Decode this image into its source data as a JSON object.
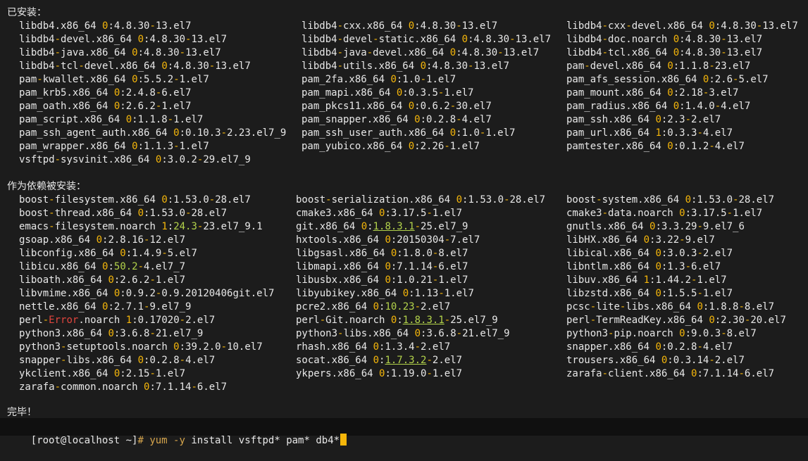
{
  "colors": {
    "background": "#1c1c1c",
    "text": "#e8e8e8",
    "epoch": "#f5b60a",
    "epoch_green": "#b3d34b",
    "hyphen": "#f5b60a",
    "error": "#e0453e",
    "command": "#d6a54c",
    "prompt_hash": "#d6a54c",
    "cursor": "#f5b60a"
  },
  "installed_heading": "已安装：",
  "installed": [
    [
      "libdb4.x86_64 0:4.8.30-13.el7",
      "libdb4-cxx.x86_64 0:4.8.30-13.el7",
      "libdb4-cxx-devel.x86_64 0:4.8.30-13.el7"
    ],
    [
      "libdb4-devel.x86_64 0:4.8.30-13.el7",
      "libdb4-devel-static.x86_64 0:4.8.30-13.el7",
      "libdb4-doc.noarch 0:4.8.30-13.el7"
    ],
    [
      "libdb4-java.x86_64 0:4.8.30-13.el7",
      "libdb4-java-devel.x86_64 0:4.8.30-13.el7",
      "libdb4-tcl.x86_64 0:4.8.30-13.el7"
    ],
    [
      "libdb4-tcl-devel.x86_64 0:4.8.30-13.el7",
      "libdb4-utils.x86_64 0:4.8.30-13.el7",
      "pam-devel.x86_64 0:1.1.8-23.el7"
    ],
    [
      "pam-kwallet.x86_64 0:5.5.2-1.el7",
      "pam_2fa.x86_64 0:1.0-1.el7",
      "pam_afs_session.x86_64 0:2.6-5.el7"
    ],
    [
      "pam_krb5.x86_64 0:2.4.8-6.el7",
      "pam_mapi.x86_64 0:0.3.5-1.el7",
      "pam_mount.x86_64 0:2.18-3.el7"
    ],
    [
      "pam_oath.x86_64 0:2.6.2-1.el7",
      "pam_pkcs11.x86_64 0:0.6.2-30.el7",
      "pam_radius.x86_64 0:1.4.0-4.el7"
    ],
    [
      "pam_script.x86_64 0:1.1.8-1.el7",
      "pam_snapper.x86_64 0:0.2.8-4.el7",
      "pam_ssh.x86_64 0:2.3-2.el7"
    ],
    [
      "pam_ssh_agent_auth.x86_64 0:0.10.3-2.23.el7_9",
      "pam_ssh_user_auth.x86_64 0:1.0-1.el7",
      "pam_url.x86_64 1:0.3.3-4.el7"
    ],
    [
      "pam_wrapper.x86_64 0:1.1.3-1.el7",
      "pam_yubico.x86_64 0:2.26-1.el7",
      "pamtester.x86_64 0:0.1.2-4.el7"
    ],
    [
      "vsftpd-sysvinit.x86_64 0:3.0.2-29.el7_9",
      "",
      ""
    ]
  ],
  "deps_heading": "作为依赖被安装：",
  "deps": [
    [
      "boost-filesystem.x86_64 0:1.53.0-28.el7",
      "boost-serialization.x86_64 0:1.53.0-28.el7",
      "boost-system.x86_64 0:1.53.0-28.el7"
    ],
    [
      "boost-thread.x86_64 0:1.53.0-28.el7",
      "cmake3.x86_64 0:3.17.5-1.el7",
      "cmake3-data.noarch 0:3.17.5-1.el7"
    ],
    [
      "emacs-filesystem.noarch 1:24.3-23.el7_9.1",
      "git.x86_64 0:1.8.3.1-25.el7_9",
      "gnutls.x86_64 0:3.3.29-9.el7_6"
    ],
    [
      "gsoap.x86_64 0:2.8.16-12.el7",
      "hxtools.x86_64 0:20150304-7.el7",
      "libHX.x86_64 0:3.22-9.el7"
    ],
    [
      "libconfig.x86_64 0:1.4.9-5.el7",
      "libgsasl.x86_64 0:1.8.0-8.el7",
      "libical.x86_64 0:3.0.3-2.el7"
    ],
    [
      "libicu.x86_64 0:50.2-4.el7_7",
      "libmapi.x86_64 0:7.1.14-6.el7",
      "libntlm.x86_64 0:1.3-6.el7"
    ],
    [
      "liboath.x86_64 0:2.6.2-1.el7",
      "libusbx.x86_64 0:1.0.21-1.el7",
      "libuv.x86_64 1:1.44.2-1.el7"
    ],
    [
      "libvmime.x86_64 0:0.9.2-0.9.20120406git.el7",
      "libyubikey.x86_64 0:1.13-1.el7",
      "libzstd.x86_64 0:1.5.5-1.el7"
    ],
    [
      "nettle.x86_64 0:2.7.1-9.el7_9",
      "pcre2.x86_64 0:10.23-2.el7",
      "pcsc-lite-libs.x86_64 0:1.8.8-8.el7"
    ],
    [
      "perl-Error.noarch 1:0.17020-2.el7",
      "perl-Git.noarch 0:1.8.3.1-25.el7_9",
      "perl-TermReadKey.x86_64 0:2.30-20.el7"
    ],
    [
      "python3.x86_64 0:3.6.8-21.el7_9",
      "python3-libs.x86_64 0:3.6.8-21.el7_9",
      "python3-pip.noarch 0:9.0.3-8.el7"
    ],
    [
      "python3-setuptools.noarch 0:39.2.0-10.el7",
      "rhash.x86_64 0:1.3.4-2.el7",
      "snapper.x86_64 0:0.2.8-4.el7"
    ],
    [
      "snapper-libs.x86_64 0:0.2.8-4.el7",
      "socat.x86_64 0:1.7.3.2-2.el7",
      "trousers.x86_64 0:0.3.14-2.el7"
    ],
    [
      "ykclient.x86_64 0:2.15-1.el7",
      "ykpers.x86_64 0:1.19.0-1.el7",
      "zarafa-client.x86_64 0:7.1.14-6.el7"
    ],
    [
      "zarafa-common.noarch 0:7.1.14-6.el7",
      "",
      ""
    ]
  ],
  "complete_text": "完毕！",
  "prompt": {
    "user_host": "[root@localhost ~]",
    "symbol": "#",
    "command_word": "yum",
    "option": "-y",
    "args": "install vsftpd* pam* db4*"
  }
}
